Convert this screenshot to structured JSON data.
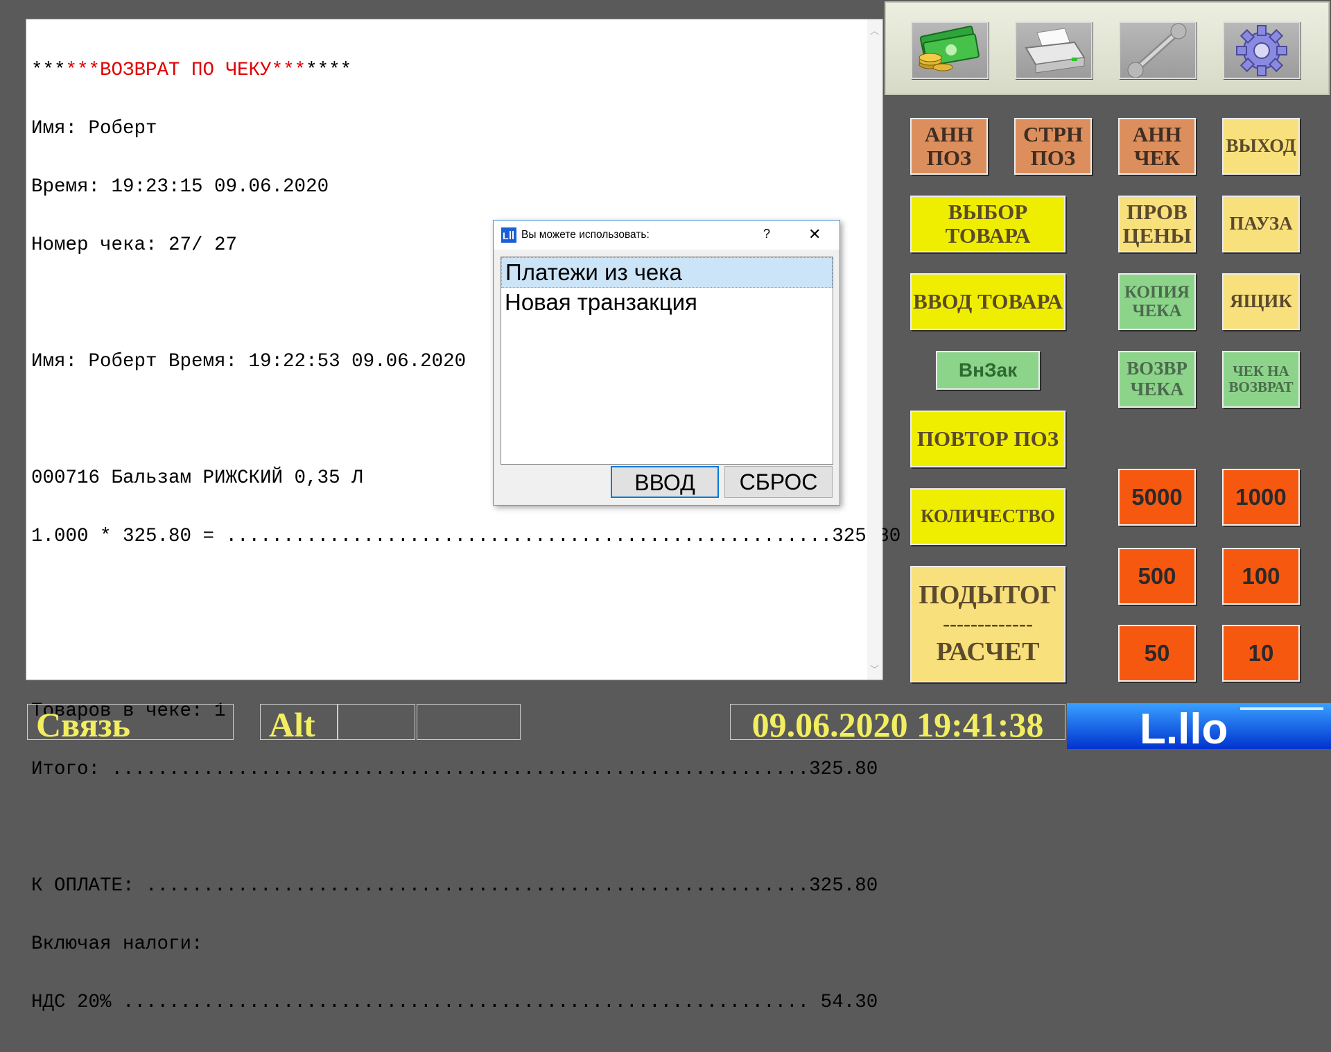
{
  "receipt": {
    "lines": [
      {
        "prefix": "***",
        "red": "***ВОЗВРАТ ПО ЧЕКУ***",
        "suffix": "****"
      },
      {
        "text": "Имя: Роберт"
      },
      {
        "text": "Время: 19:23:15 09.06.2020"
      },
      {
        "text": "Номер чека: 27/ 27"
      },
      {
        "text": ""
      },
      {
        "text": "Имя: Роберт Время: 19:22:53 09.06.2020"
      },
      {
        "text": ""
      },
      {
        "text": "000716 Бальзам РИЖСКИЙ 0,35 Л"
      },
      {
        "text": "1.000 * 325.80 = .....................................................325.80"
      },
      {
        "text": ""
      },
      {
        "text": ""
      },
      {
        "text": "Товаров в чеке: 1"
      },
      {
        "text": "Итого: .............................................................325.80"
      },
      {
        "text": ""
      },
      {
        "text": "К ОПЛАТЕ: ..........................................................325.80"
      },
      {
        "text": "Включая налоги:"
      },
      {
        "text": "НДС 20% ............................................................ 54.30"
      }
    ]
  },
  "toolbar": {
    "icons": [
      "money-icon",
      "printer-icon",
      "wrench-icon",
      "gear-icon"
    ]
  },
  "buttons": {
    "ann_poz": "АНН ПОЗ",
    "strn_poz": "СТРН ПОЗ",
    "ann_chek": "АНН ЧЕК",
    "exit": "ВЫХОД",
    "vybor_tovara": "ВЫБОР ТОВАРА",
    "prov_ceny": "ПРОВ ЦЕНЫ",
    "pause": "ПАУЗА",
    "vvod_tovara": "ВВОД ТОВАРА",
    "kopiya_cheka": "КОПИЯ ЧЕКА",
    "yashchik": "ЯЩИК",
    "vnzak": "ВнЗак",
    "vozvr_cheka": "ВОЗВР ЧЕКА",
    "chek_na_vozvrat": "ЧЕК НА ВОЗВРАТ",
    "povtor_poz": "ПОВТОР ПОЗ",
    "kolichestvo": "КОЛИЧЕСТВО",
    "podytog": "ПОДЫТОГ",
    "podytog_sep": "-------------",
    "raschet": "РАСЧЕТ",
    "m5000": "5000",
    "m1000": "1000",
    "m500": "500",
    "m100": "100",
    "m50": "50",
    "m10": "10"
  },
  "status": {
    "connection": "Связь",
    "alt": "Alt",
    "datetime": "09.06.2020 19:41:38",
    "logo": "L.llo"
  },
  "dialog": {
    "title": "Вы можете использовать:",
    "help": "?",
    "close": "✕",
    "items": [
      "Платежи из чека",
      "Новая транзакция"
    ],
    "ok": "ВВОД",
    "reset": "СБРОС"
  },
  "colors": {
    "orange": "#dc8e5c",
    "yellow": "#f0ee00",
    "light_yellow": "#f8e07c",
    "green": "#8cd48a",
    "money": "#f65810",
    "status_text": "#f2ee60"
  }
}
